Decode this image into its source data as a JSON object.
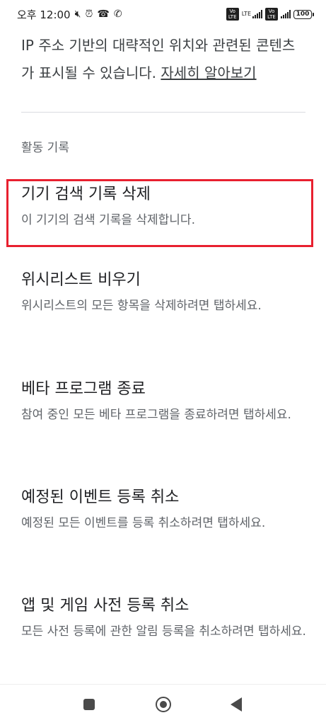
{
  "status_bar": {
    "time": "오후 12:00",
    "icons": [
      "mute-icon",
      "alarm-icon",
      "wifi-call-icon",
      "volte-icon"
    ],
    "battery": "100",
    "network": "LTE"
  },
  "intro": {
    "text": "IP 주소 기반의 대략적인 위치와 관련된 콘텐츠가 표시될 수 있습니다. ",
    "learn_more": "자세히 알아보기"
  },
  "section": {
    "header": "활동 기록"
  },
  "items": [
    {
      "title": "기기 검색 기록 삭제",
      "subtitle": "이 기기의 검색 기록을 삭제합니다."
    },
    {
      "title": "위시리스트 비우기",
      "subtitle": "위시리스트의 모든 항목을 삭제하려면 탭하세요."
    },
    {
      "title": "베타 프로그램 종료",
      "subtitle": "참여 중인 모든 베타 프로그램을 종료하려면 탭하세요."
    },
    {
      "title": "예정된 이벤트 등록 취소",
      "subtitle": "예정된 모든 이벤트를 등록 취소하려면 탭하세요."
    },
    {
      "title": "앱 및 게임 사전 등록 취소",
      "subtitle": "모든 사전 등록에 관한 알림 등록을 취소하려면 탭하세요."
    }
  ],
  "highlight_color": "#e8202f",
  "nav": {
    "icons": [
      "recents-icon",
      "home-icon",
      "back-icon"
    ]
  }
}
